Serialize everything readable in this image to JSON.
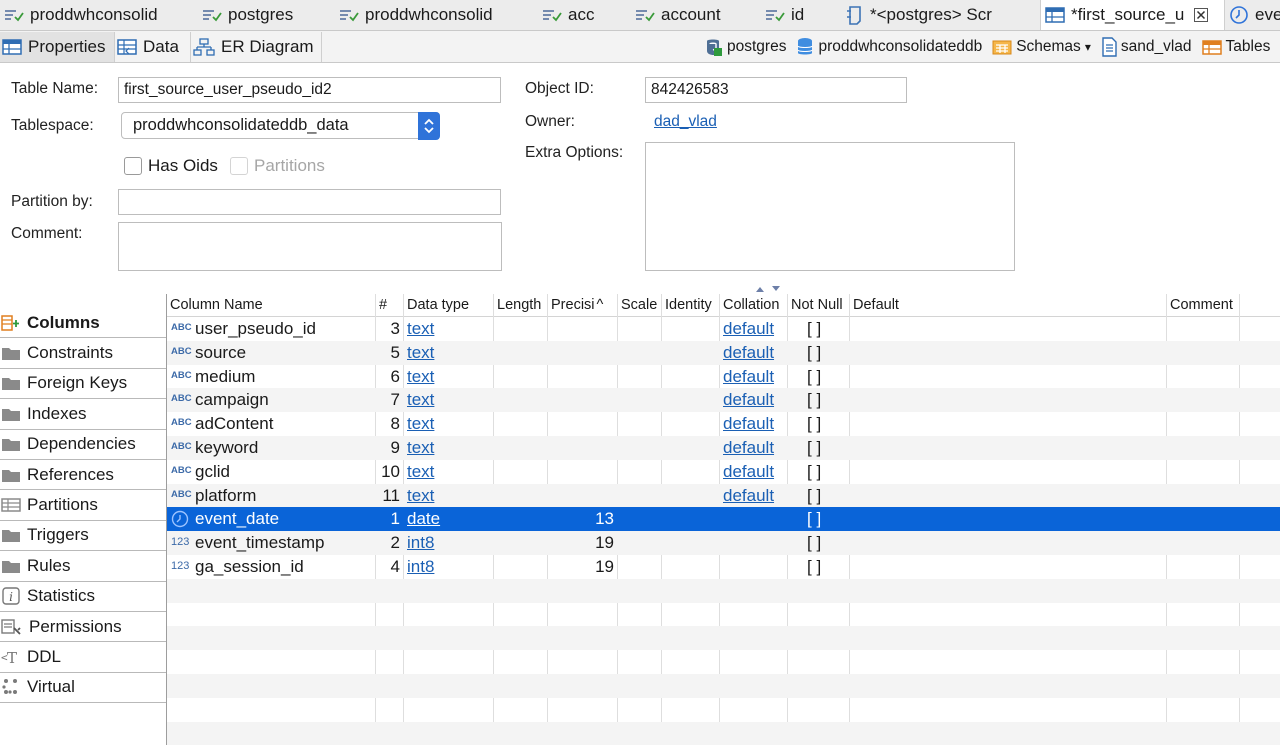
{
  "editor_tabs": [
    {
      "label": "proddwhconsolid",
      "icon": "sql-script-icon"
    },
    {
      "label": "postgres",
      "icon": "sql-script-icon"
    },
    {
      "label": "proddwhconsolid",
      "icon": "sql-script-icon"
    },
    {
      "label": "acc",
      "icon": "sql-script-icon"
    },
    {
      "label": "account",
      "icon": "sql-script-icon"
    },
    {
      "label": "id",
      "icon": "sql-script-icon"
    },
    {
      "label": "*<postgres> Scr",
      "icon": "script-file-icon"
    },
    {
      "label": "*first_source_u",
      "icon": "table-icon",
      "active": true
    },
    {
      "label": "eve",
      "icon": "clock-icon"
    }
  ],
  "view_tabs": [
    {
      "label": "Properties",
      "active": true
    },
    {
      "label": "Data"
    },
    {
      "label": "ER Diagram"
    }
  ],
  "breadcrumbs": [
    {
      "label": "postgres"
    },
    {
      "label": "proddwhconsolidateddb"
    },
    {
      "label": "Schemas",
      "dropdown": "▾"
    },
    {
      "label": "sand_vlad"
    },
    {
      "label": "Tables"
    }
  ],
  "form": {
    "table_name_label": "Table Name:",
    "table_name_value": "first_source_user_pseudo_id2",
    "tablespace_label": "Tablespace:",
    "tablespace_value": "proddwhconsolidateddb_data",
    "has_oids_label": "Has Oids",
    "partitions_label": "Partitions",
    "partition_by_label": "Partition by:",
    "partition_by_value": "",
    "comment_label": "Comment:",
    "object_id_label": "Object ID:",
    "object_id_value": "842426583",
    "owner_label": "Owner:",
    "owner_value": "dad_vlad",
    "extra_options_label": "Extra Options:"
  },
  "nav": [
    {
      "label": "Columns",
      "icon": "columns-icon",
      "active": true
    },
    {
      "label": "Constraints",
      "icon": "folder-icon"
    },
    {
      "label": "Foreign Keys",
      "icon": "folder-icon"
    },
    {
      "label": "Indexes",
      "icon": "folder-icon"
    },
    {
      "label": "Dependencies",
      "icon": "folder-icon"
    },
    {
      "label": "References",
      "icon": "folder-icon"
    },
    {
      "label": "Partitions",
      "icon": "partitions-icon"
    },
    {
      "label": "Triggers",
      "icon": "folder-icon"
    },
    {
      "label": "Rules",
      "icon": "folder-icon"
    },
    {
      "label": "Statistics",
      "icon": "info-icon"
    },
    {
      "label": "Permissions",
      "icon": "permissions-icon"
    },
    {
      "label": "DDL",
      "icon": "ddl-icon"
    },
    {
      "label": "Virtual",
      "icon": "virtual-icon"
    }
  ],
  "columns_header": [
    "Column Name",
    "#",
    "Data type",
    "Length",
    "Precisi",
    "Scale",
    "Identity",
    "Collation",
    "Not Null",
    "Default",
    "Comment"
  ],
  "sort_indicator": "^",
  "columns_rows": [
    {
      "icon": "ABC",
      "name": "user_pseudo_id",
      "num": "3",
      "type": "text",
      "precision": "",
      "collation": "default",
      "not_null": "[ ]"
    },
    {
      "icon": "ABC",
      "name": "source",
      "num": "5",
      "type": "text",
      "precision": "",
      "collation": "default",
      "not_null": "[ ]"
    },
    {
      "icon": "ABC",
      "name": "medium",
      "num": "6",
      "type": "text",
      "precision": "",
      "collation": "default",
      "not_null": "[ ]"
    },
    {
      "icon": "ABC",
      "name": "campaign",
      "num": "7",
      "type": "text",
      "precision": "",
      "collation": "default",
      "not_null": "[ ]"
    },
    {
      "icon": "ABC",
      "name": "adContent",
      "num": "8",
      "type": "text",
      "precision": "",
      "collation": "default",
      "not_null": "[ ]"
    },
    {
      "icon": "ABC",
      "name": "keyword",
      "num": "9",
      "type": "text",
      "precision": "",
      "collation": "default",
      "not_null": "[ ]"
    },
    {
      "icon": "ABC",
      "name": "gclid",
      "num": "10",
      "type": "text",
      "precision": "",
      "collation": "default",
      "not_null": "[ ]"
    },
    {
      "icon": "ABC",
      "name": "platform",
      "num": "11",
      "type": "text",
      "precision": "",
      "collation": "default",
      "not_null": "[ ]"
    },
    {
      "icon": "clock",
      "name": "event_date",
      "num": "1",
      "type": "date",
      "precision": "13",
      "collation": "",
      "not_null": "[ ]",
      "selected": true
    },
    {
      "icon": "123",
      "name": "event_timestamp",
      "num": "2",
      "type": "int8",
      "precision": "19",
      "collation": "",
      "not_null": "[ ]"
    },
    {
      "icon": "123",
      "name": "ga_session_id",
      "num": "4",
      "type": "int8",
      "precision": "19",
      "collation": "",
      "not_null": "[ ]"
    }
  ],
  "colors": {
    "accent": "#0a64d8",
    "link": "#1a5fb4",
    "stepper": "#2f73d9"
  }
}
